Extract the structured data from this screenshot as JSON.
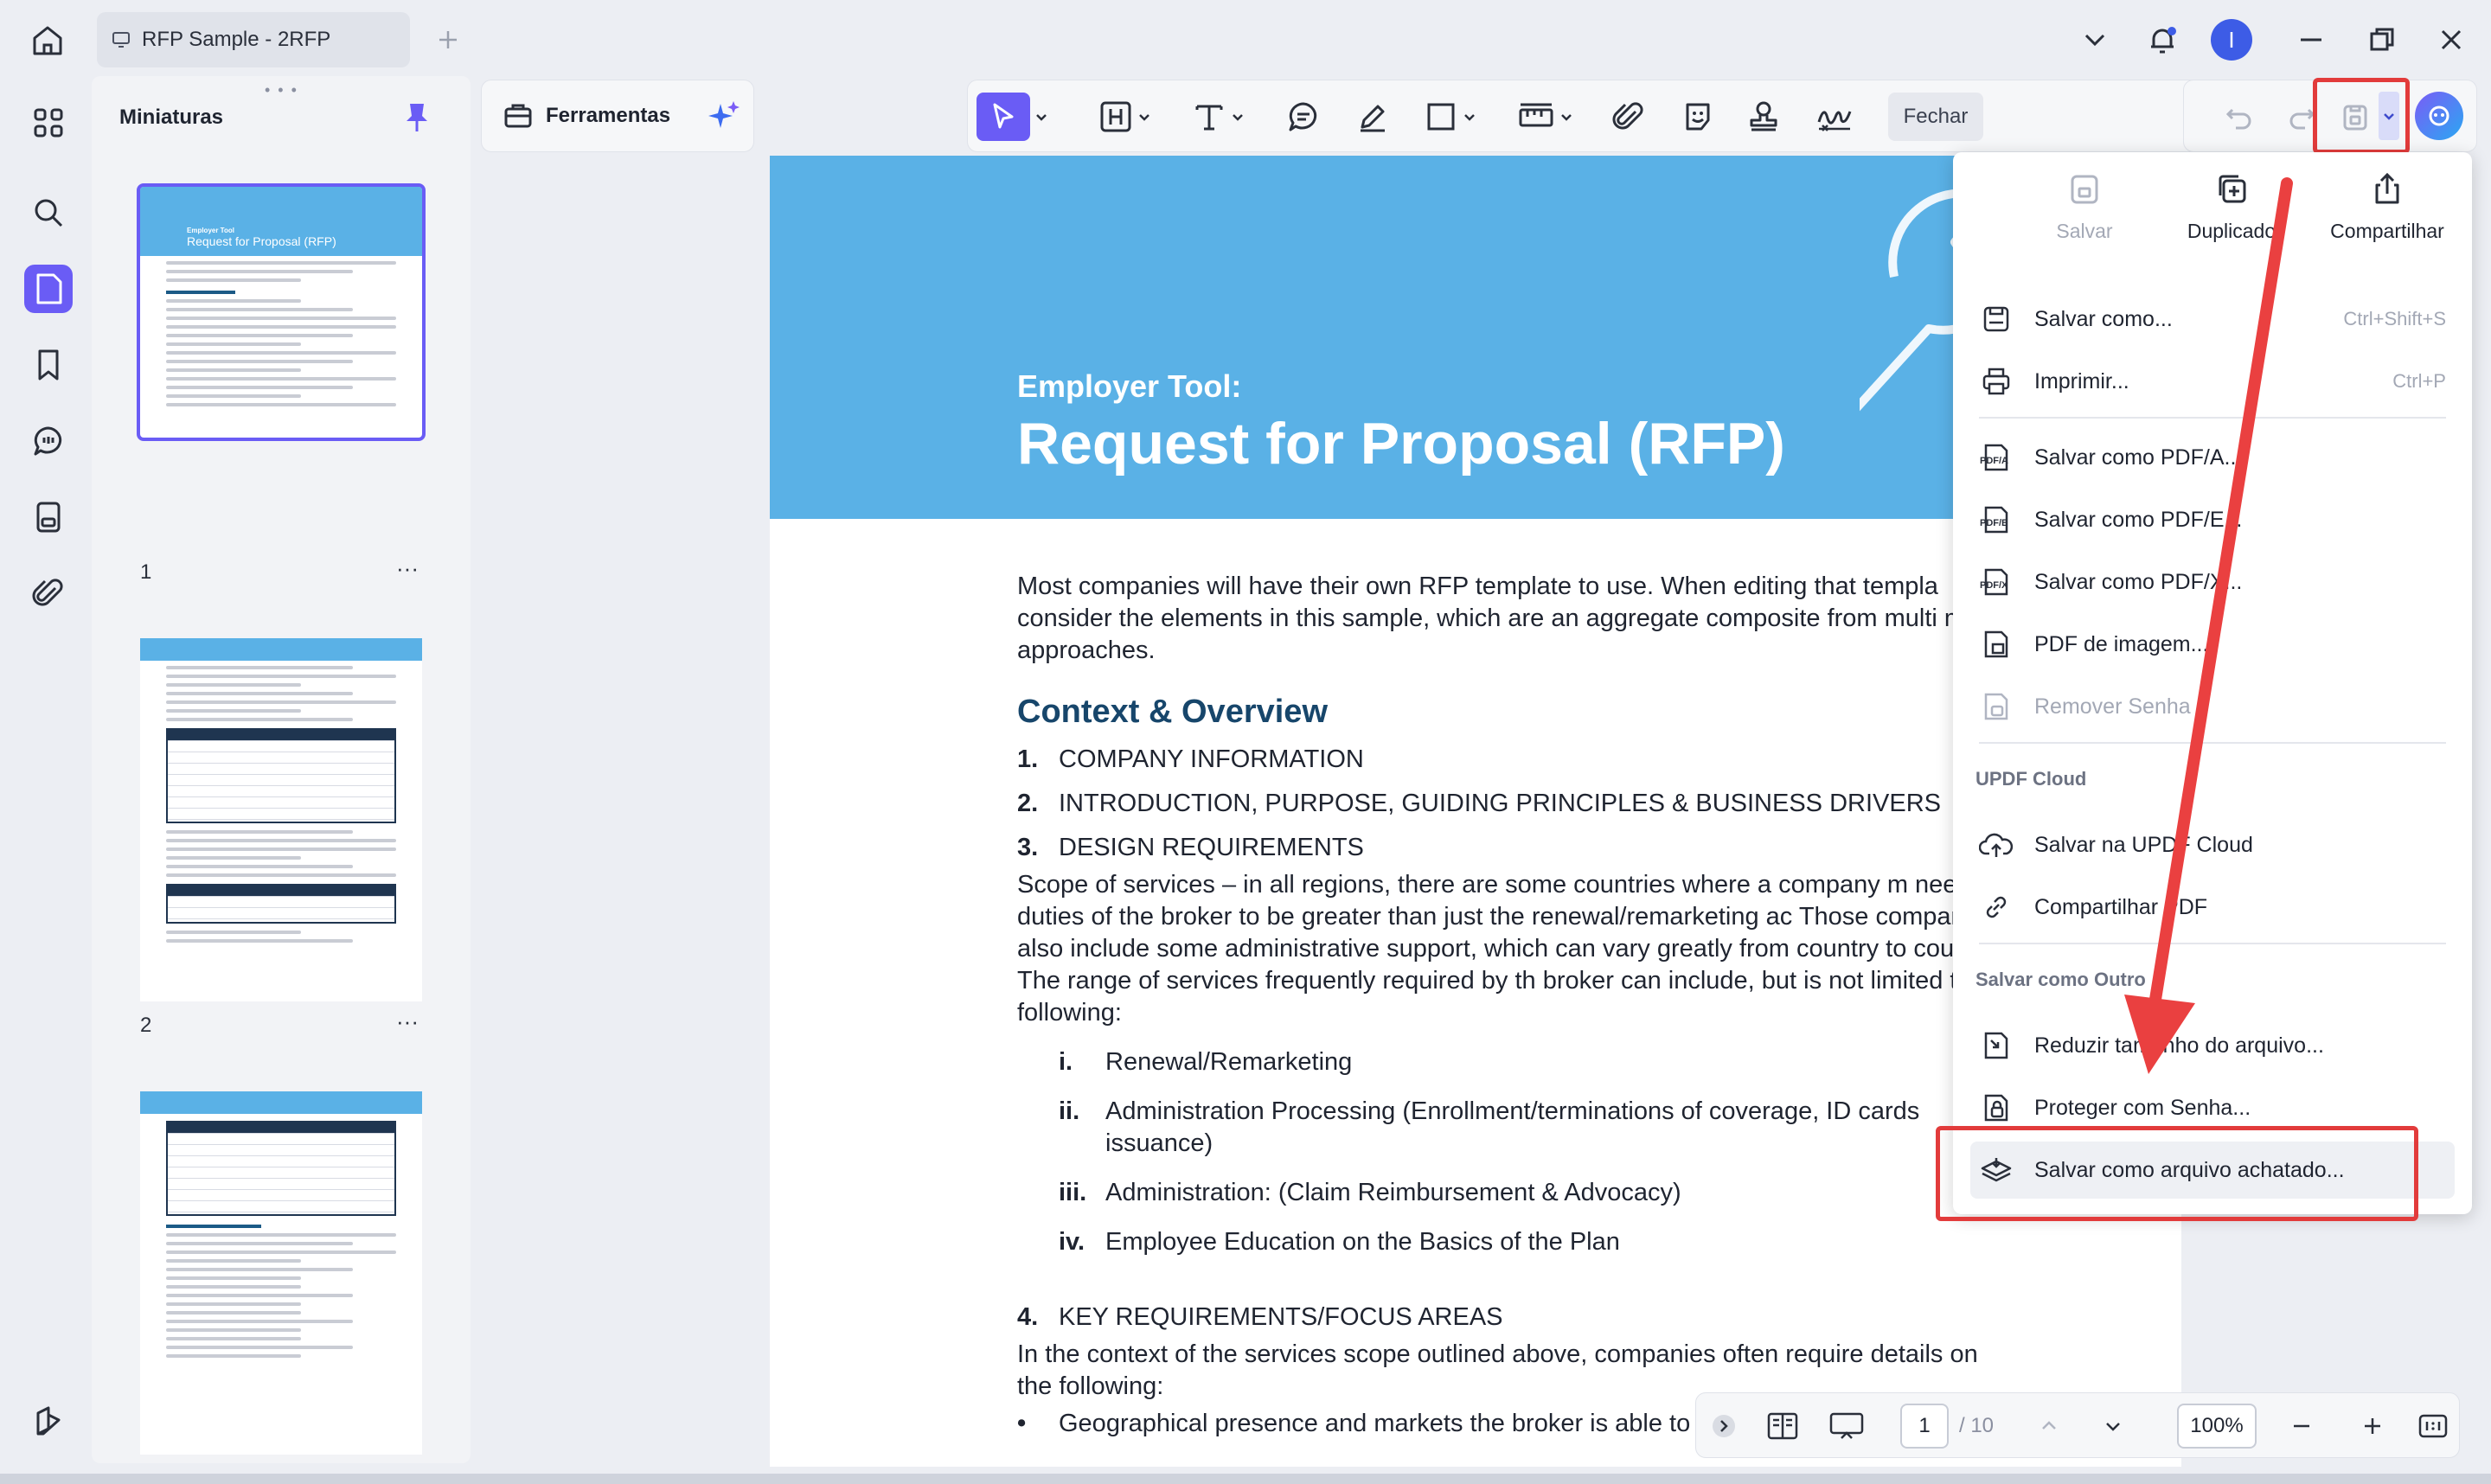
{
  "tab": {
    "title": "RFP Sample - 2RFP"
  },
  "avatar": {
    "initial": "I"
  },
  "thumbnails": {
    "title": "Miniaturas",
    "pages": [
      {
        "number": "1",
        "head_small": "Employer Tool",
        "head_big": "Request for Proposal (RFP)"
      },
      {
        "number": "2"
      },
      {
        "number": ""
      }
    ]
  },
  "tools": {
    "label": "Ferramentas"
  },
  "annot": {
    "close_label": "Fechar"
  },
  "document": {
    "kicker": "Employer Tool:",
    "title": "Request for Proposal (RFP)",
    "intro": "Most companies will have their own RFP template to use. When editing that templa consider the elements in this sample, which are an aggregate composite from multi member approaches.",
    "section_title": "Context & Overview",
    "items": [
      {
        "num": "1.",
        "text": "COMPANY INFORMATION"
      },
      {
        "num": "2.",
        "text": "INTRODUCTION, PURPOSE, GUIDING PRINCIPLES & BUSINESS DRIVERS"
      },
      {
        "num": "3.",
        "text": "DESIGN REQUIREMENTS"
      }
    ],
    "scope_text": "Scope of services – in all regions, there are some countries where a company m need the duties of the broker to be greater than just the renewal/remarketing ac Those company may also include some administrative support, which can vary greatly from country to country. The range of services frequently required by th broker can include, but is not limited to, the following:",
    "roman": [
      {
        "num": "i.",
        "text": "Renewal/Remarketing"
      },
      {
        "num": "ii.",
        "text": "Administration Processing (Enrollment/terminations of coverage, ID cards issuance)"
      },
      {
        "num": "iii.",
        "text": "Administration: (Claim Reimbursement & Advocacy)"
      },
      {
        "num": "iv.",
        "text": "Employee Education on the Basics of the Plan"
      }
    ],
    "item4_num": "4.",
    "item4_text": "KEY REQUIREMENTS/FOCUS AREAS",
    "context_text": "In the context of the services scope outlined above, companies often require details on the following:",
    "bullet_text": "Geographical presence and markets the broker is able to"
  },
  "nav": {
    "page": "1",
    "total": "/ 10",
    "zoom": "100%"
  },
  "menu": {
    "top_actions": [
      {
        "label": "Salvar",
        "disabled": true
      },
      {
        "label": "Duplicado"
      },
      {
        "label": "Compartilhar"
      }
    ],
    "items": [
      {
        "label": "Salvar como...",
        "shortcut": "Ctrl+Shift+S"
      },
      {
        "label": "Imprimir...",
        "shortcut": "Ctrl+P"
      },
      {
        "label": "Salvar como PDF/A..."
      },
      {
        "label": "Salvar como PDF/E..."
      },
      {
        "label": "Salvar como PDF/X..."
      },
      {
        "label": "PDF de imagem..."
      },
      {
        "label": "Remover Senha",
        "disabled": true
      },
      {
        "label": "Salvar na UPDF Cloud"
      },
      {
        "label": "Compartilhar PDF"
      },
      {
        "label": "Reduzir tamanho do arquivo..."
      },
      {
        "label": "Proteger com Senha..."
      },
      {
        "label": "Salvar como arquivo achatado..."
      }
    ],
    "section_cloud": "UPDF Cloud",
    "section_other": "Salvar como Outro"
  }
}
